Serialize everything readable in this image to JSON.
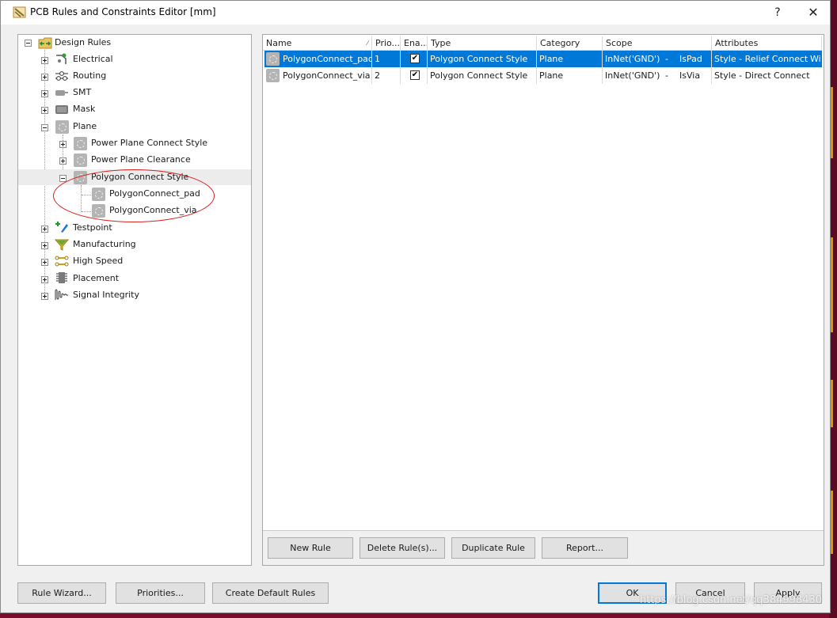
{
  "window": {
    "title": "PCB Rules and Constraints Editor [mm]",
    "help_label": "?",
    "close_label": "✕"
  },
  "tree": {
    "root": "Design Rules",
    "items": [
      {
        "label": "Electrical",
        "icon": "electrical-icon"
      },
      {
        "label": "Routing",
        "icon": "routing-icon"
      },
      {
        "label": "SMT",
        "icon": "smt-icon"
      },
      {
        "label": "Mask",
        "icon": "mask-icon"
      },
      {
        "label": "Plane",
        "icon": "plane-icon"
      },
      {
        "label": "Power Plane Connect Style",
        "icon": "rule-icon"
      },
      {
        "label": "Power Plane Clearance",
        "icon": "rule-icon"
      },
      {
        "label": "Polygon Connect Style",
        "icon": "rule-icon"
      },
      {
        "label": "PolygonConnect_pad",
        "icon": "rule-icon"
      },
      {
        "label": "PolygonConnect_via",
        "icon": "rule-icon"
      },
      {
        "label": "Testpoint",
        "icon": "testpoint-icon"
      },
      {
        "label": "Manufacturing",
        "icon": "manufacturing-icon"
      },
      {
        "label": "High Speed",
        "icon": "high-speed-icon"
      },
      {
        "label": "Placement",
        "icon": "placement-icon"
      },
      {
        "label": "Signal Integrity",
        "icon": "signal-integrity-icon"
      }
    ]
  },
  "grid": {
    "columns": [
      "Name",
      "Prio...",
      "Ena...",
      "Type",
      "Category",
      "Scope",
      "Attributes"
    ],
    "sort_indicator": "⁄",
    "rows": [
      {
        "name": "PolygonConnect_pad",
        "priority": "1",
        "enabled": "✔",
        "type": "Polygon Connect Style",
        "category": "Plane",
        "scope": "InNet('GND')",
        "scope2": "-",
        "scope3": "IsPad",
        "attributes": "Style - Relief Connect",
        "attributes2": "Wi",
        "selected": true
      },
      {
        "name": "PolygonConnect_via",
        "priority": "2",
        "enabled": "✔",
        "type": "Polygon Connect Style",
        "category": "Plane",
        "scope": "InNet('GND')",
        "scope2": "-",
        "scope3": "IsVia",
        "attributes": "Style - Direct Connect",
        "attributes2": "",
        "selected": false
      }
    ]
  },
  "grid_buttons": {
    "new_rule": "New Rule",
    "delete_rule": "Delete Rule(s)...",
    "duplicate_rule": "Duplicate Rule",
    "report": "Report..."
  },
  "footer": {
    "rule_wizard": "Rule Wizard...",
    "priorities": "Priorities...",
    "create_default": "Create Default Rules",
    "ok": "OK",
    "cancel": "Cancel",
    "apply": "Apply"
  },
  "watermark": "https://blog.csdn.net/qq384998430",
  "colors": {
    "selection": "#0078d7",
    "annotation": "#d92020",
    "background": "#7a0c2e"
  }
}
